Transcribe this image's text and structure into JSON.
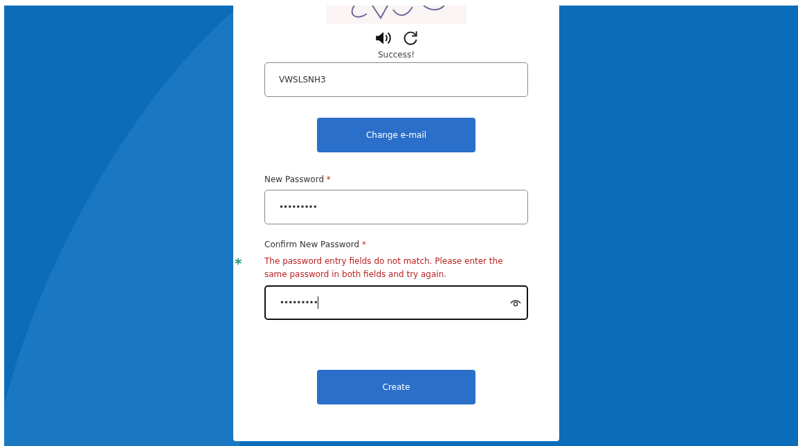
{
  "captcha": {
    "status": "Success!",
    "answer": "VWSLSNH3"
  },
  "change_email_button": "Change e-mail",
  "fields": [
    {
      "label": "New Password",
      "required_mark": "*",
      "value": "•••••••••",
      "focused": false,
      "show_toggle": false
    },
    {
      "label": "Confirm New Password",
      "required_mark": "*",
      "error_marker": "*",
      "error": "The password entry fields do not match. Please enter the same password in both fields and try again.",
      "value": "•••••••••",
      "focused": true,
      "show_toggle": true
    }
  ],
  "submit_button": "Create"
}
